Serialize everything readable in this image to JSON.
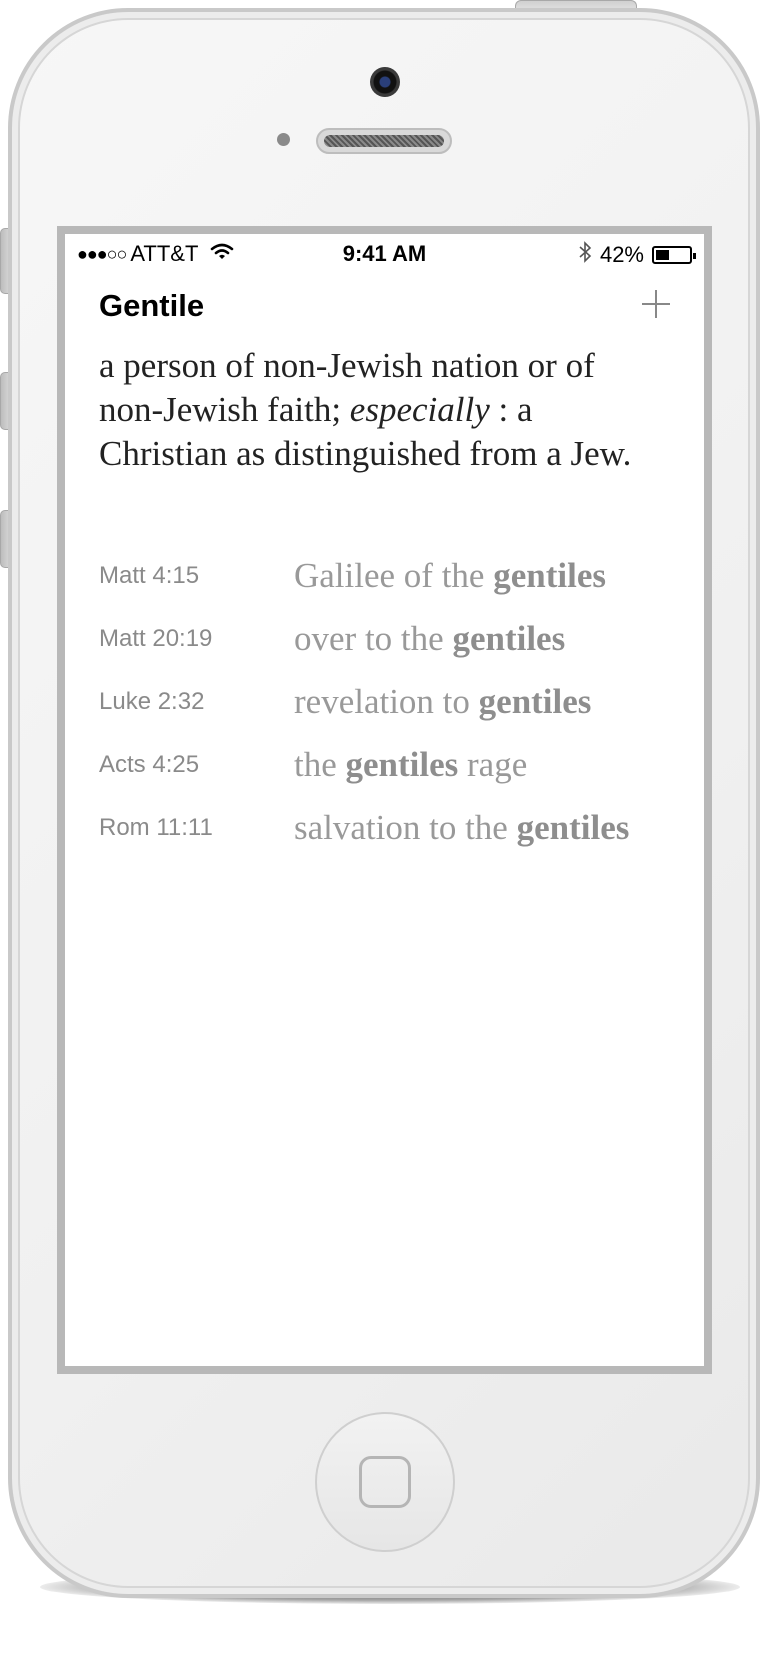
{
  "status_bar": {
    "signal_dots": "●●●○○",
    "carrier": "ATT&T",
    "time": "9:41 AM",
    "battery": "42%",
    "battery_level": 0.42
  },
  "nav": {
    "title": "Gentile",
    "add_icon": "plus-icon"
  },
  "definition": {
    "part1": "a person of non-Jewish nation or of non-Jewish faith; ",
    "emphasis": "especially",
    "part2": " : a Christian as distinguished from a Jew."
  },
  "references": [
    {
      "ref": "Matt 4:15",
      "before": "Galilee of the ",
      "keyword": "gentiles",
      "after": ""
    },
    {
      "ref": "Matt 20:19",
      "before": "over to the ",
      "keyword": "gentiles",
      "after": ""
    },
    {
      "ref": "Luke 2:32",
      "before": "revelation to ",
      "keyword": "gentiles",
      "after": ""
    },
    {
      "ref": "Acts 4:25",
      "before": "the ",
      "keyword": "gentiles",
      "after": " rage"
    },
    {
      "ref": "Rom 11:11",
      "before": "salvation to the ",
      "keyword": "gentiles",
      "after": ""
    }
  ]
}
